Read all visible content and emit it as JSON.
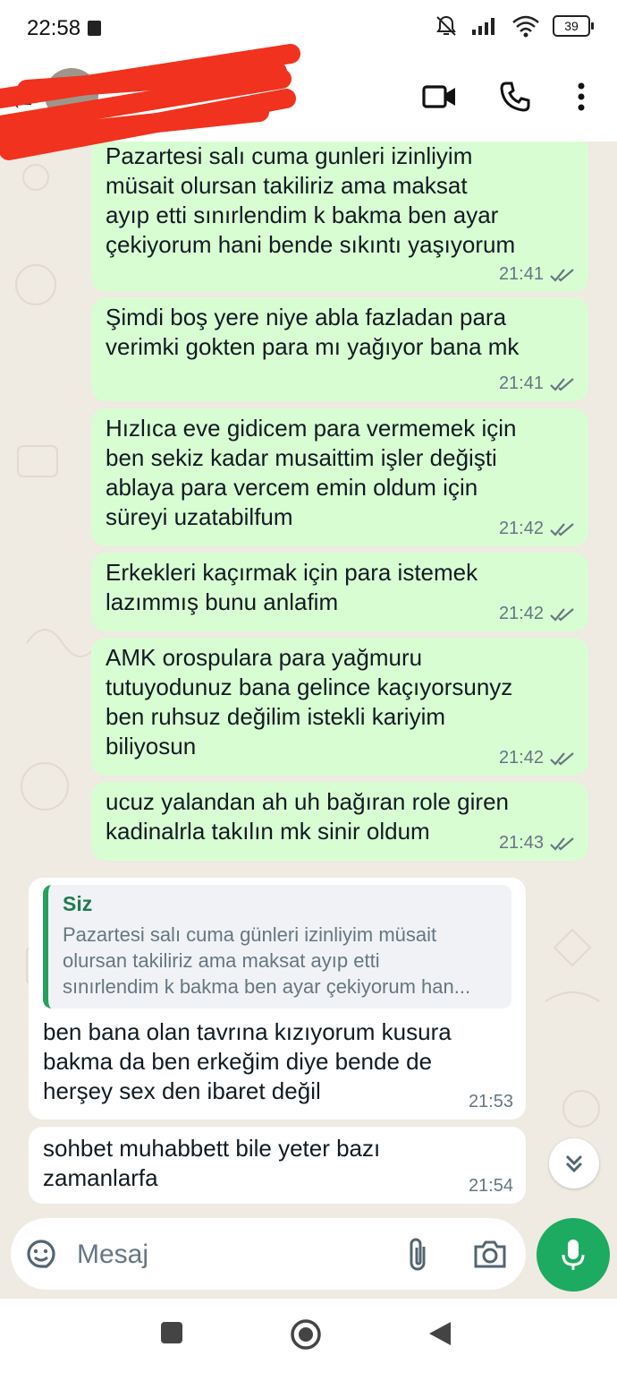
{
  "status_bar": {
    "time": "22:58",
    "battery": "39"
  },
  "header": {
    "contact_name": "",
    "icons": [
      "video-call-icon",
      "phone-icon",
      "more-icon"
    ]
  },
  "messages_out": [
    {
      "text": "Pazartesi salı cuma gunleri izinliyim\nmüsait olursan takiliriz ama maksat\nayıp etti  sınırlendim k bakma ben ayar\nçekiyorum hani bende sıkıntı yaşıyorum",
      "time": "21:41"
    },
    {
      "text": "Şimdi boş yere niye abla fazladan para\nverimki gokten para mı yağıyor bana mk",
      "time": "21:41"
    },
    {
      "text": "Hızlıca eve gidicem para vermemek için\nben sekiz kadar musaittim işler değişti\nablaya para vercem emin oldum için\nsüreyi uzatabilfum",
      "time": "21:42"
    },
    {
      "text": "Erkekleri kaçırmak için para istemek\nlazımmış bunu anlafim",
      "time": "21:42"
    },
    {
      "text": "AMK orospulara para yağmuru\ntutuyodunuz bana gelince kaçıyorsunyz\nben ruhsuz değilim istekli kariyim\nbiliyosun",
      "time": "21:42"
    },
    {
      "text": "ucuz yalandan ah uh bağıran role giren\nkadinalrla takılın mk sinir oldum",
      "time": "21:43"
    }
  ],
  "messages_in": [
    {
      "quote_author": "Siz",
      "quote_text": "Pazartesi salı cuma günleri izinliyim müsait\nolursan takiliriz ama maksat ayıp etti\nsınırlendim k bakma ben ayar çekiyorum han...",
      "text": "ben bana olan tavrına kızıyorum kusura\nbakma da ben erkeğim diye bende  de\nherşey sex den ibaret değil",
      "time": "21:53"
    },
    {
      "text": "sohbet muhabbett bile yeter bazı\nzamanlarfa",
      "time": "21:54"
    }
  ],
  "composer": {
    "placeholder": "Mesaj"
  },
  "colors": {
    "outgoing_bubble": "#d9fdd3",
    "incoming_bubble": "#ffffff",
    "accent_green": "#1daa61",
    "read_ticks": "#667781"
  }
}
